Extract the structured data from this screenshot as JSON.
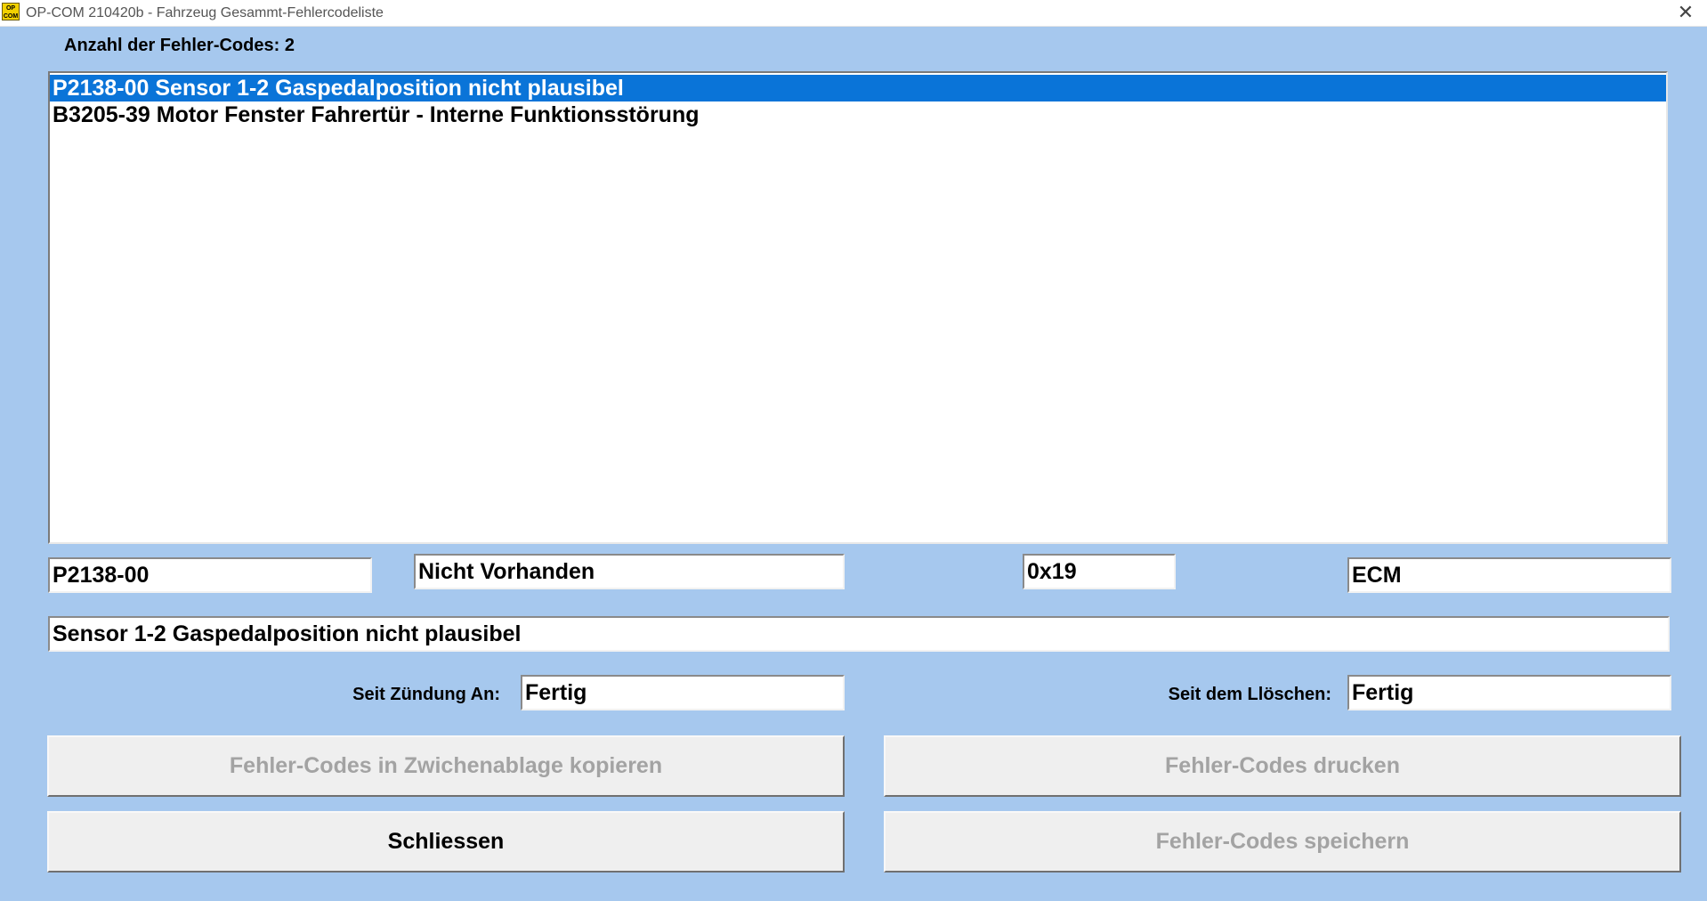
{
  "window": {
    "title": "OP-COM 210420b - Fahrzeug Gesammt-Fehlercodeliste",
    "icon_text": "OP COM",
    "close_glyph": "✕"
  },
  "header": {
    "count_label": "Anzahl der Fehler-Codes: 2"
  },
  "codes": [
    {
      "text": "P2138-00 Sensor 1-2 Gaspedalposition nicht plausibel",
      "selected": true
    },
    {
      "text": "B3205-39 Motor Fenster Fahrertür - Interne Funktionsstörung",
      "selected": false
    }
  ],
  "detail": {
    "code": "P2138-00",
    "status": "Nicht Vorhanden",
    "hex": "0x19",
    "module": "ECM",
    "description": "Sensor 1-2 Gaspedalposition nicht plausibel",
    "since_ignition_label": "Seit Zündung An:",
    "since_ignition_value": "Fertig",
    "since_clear_label": "Seit dem Llöschen:",
    "since_clear_value": "Fertig"
  },
  "buttons": {
    "copy": "Fehler-Codes in Zwichenablage kopieren",
    "print": "Fehler-Codes drucken",
    "close": "Schliessen",
    "save": "Fehler-Codes speichern"
  },
  "colors": {
    "background": "#a6c8ee",
    "selection": "#0a74d8",
    "disabled_text": "#a3a3a3"
  }
}
